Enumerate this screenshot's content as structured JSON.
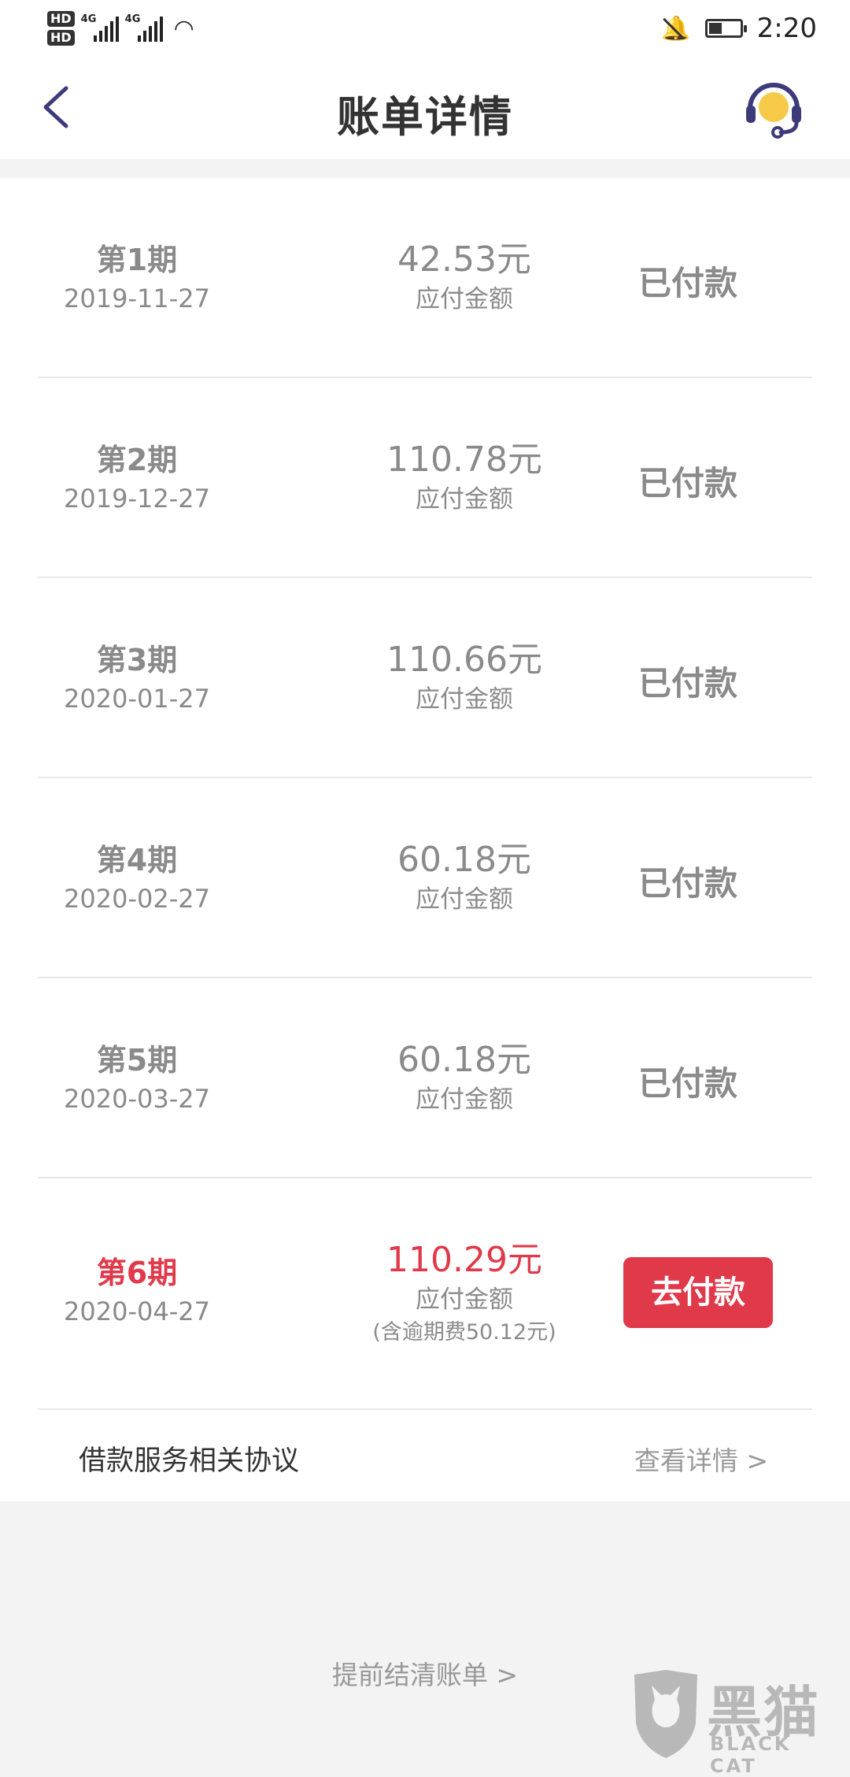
{
  "statusbar": {
    "hd1": "HD",
    "hd2": "HD",
    "net1": "4G",
    "net2": "4G",
    "time": "2:20"
  },
  "header": {
    "title": "账单详情"
  },
  "bills": [
    {
      "period": "第1期",
      "date": "2019-11-27",
      "amount": "42.53元",
      "amount_label": "应付金额",
      "status": "已付款"
    },
    {
      "period": "第2期",
      "date": "2019-12-27",
      "amount": "110.78元",
      "amount_label": "应付金额",
      "status": "已付款"
    },
    {
      "period": "第3期",
      "date": "2020-01-27",
      "amount": "110.66元",
      "amount_label": "应付金额",
      "status": "已付款"
    },
    {
      "period": "第4期",
      "date": "2020-02-27",
      "amount": "60.18元",
      "amount_label": "应付金额",
      "status": "已付款"
    },
    {
      "period": "第5期",
      "date": "2020-03-27",
      "amount": "60.18元",
      "amount_label": "应付金额",
      "status": "已付款"
    },
    {
      "period": "第6期",
      "date": "2020-04-27",
      "amount": "110.29元",
      "amount_label": "应付金额",
      "note": "(含逾期费50.12元)",
      "action": "去付款"
    }
  ],
  "agreement": {
    "label": "借款服务相关协议",
    "link": "查看详情 >"
  },
  "prepay": {
    "label": "提前结清账单 >"
  },
  "watermark": {
    "cn": "黑猫",
    "en": "BLACK CAT"
  },
  "colors": {
    "accent": "#e03a4a",
    "muted": "#8a8a8a",
    "headset": "#3d3a7a",
    "headset_fill": "#f7c948"
  }
}
